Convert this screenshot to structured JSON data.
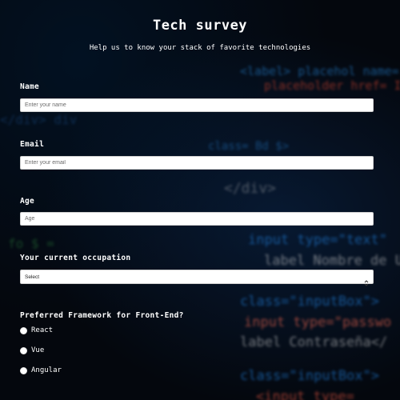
{
  "header": {
    "title": "Tech survey",
    "description": "Help us to know your stack of favorite technologies"
  },
  "form": {
    "name": {
      "label": "Name",
      "placeholder": "Enter your name",
      "value": ""
    },
    "email": {
      "label": "Email",
      "placeholder": "Enter your email",
      "value": ""
    },
    "age": {
      "label": "Age",
      "placeholder": "Age",
      "value": ""
    },
    "occupation": {
      "label": "Your current occupation",
      "selected": "Select"
    },
    "framework": {
      "label": "Preferred Framework for Front-End?",
      "options": [
        {
          "label": "React",
          "checked": false
        },
        {
          "label": "Vue",
          "checked": false
        },
        {
          "label": "Angular",
          "checked": false
        }
      ]
    }
  },
  "background": {
    "code_lines": [
      "class=\"inputBox\">",
      "input type=\"passwo",
      "label Contraseña</",
      "input type=\"text\" ",
      "label Nombre de Us",
      "placeholder href= I",
      "class= inputBox",
      "</div>"
    ]
  },
  "colors": {
    "page_background": "#05080f",
    "text": "#ffffff",
    "field_background": "#ffffff",
    "code_blue": "#1c6fc0",
    "code_red": "#d05a48"
  }
}
